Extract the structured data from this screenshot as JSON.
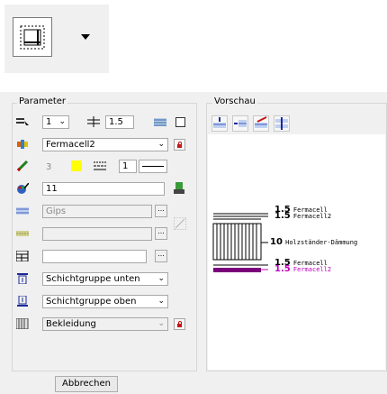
{
  "colors": {
    "accent_yellow": "#ffff00",
    "layer_purple": "#7b007b",
    "lock_red": "#c81414"
  },
  "parameter": {
    "title": "Parameter",
    "row1": {
      "pen_value": "1",
      "thickness_value": "1.5"
    },
    "row2": {
      "material": "Fermacell2"
    },
    "row3": {
      "pen_value": "3",
      "linetype_value": "1"
    },
    "row4": {
      "color_value": "11"
    },
    "row5": {
      "hatch_text": "Gips"
    },
    "row6": {
      "pattern_text": ""
    },
    "row7": {
      "field_text": ""
    },
    "row8": {
      "group_below": "Schichtgruppe unten"
    },
    "row9": {
      "group_above": "Schichtgruppe oben"
    },
    "row10": {
      "category": "Bekleidung"
    }
  },
  "preview": {
    "title": "Vorschau",
    "labels": [
      {
        "value": "1.5",
        "name": "Fermacell"
      },
      {
        "value": "1.5",
        "name": "Fermacell2"
      },
      {
        "value": "10",
        "name": "Holzständer-Dämmung"
      },
      {
        "value": "1.5",
        "name": "Fermacell"
      },
      {
        "value": "1.5",
        "name": "Fermacell2"
      }
    ]
  },
  "footer": {
    "cancel_label": "Abbrechen"
  }
}
